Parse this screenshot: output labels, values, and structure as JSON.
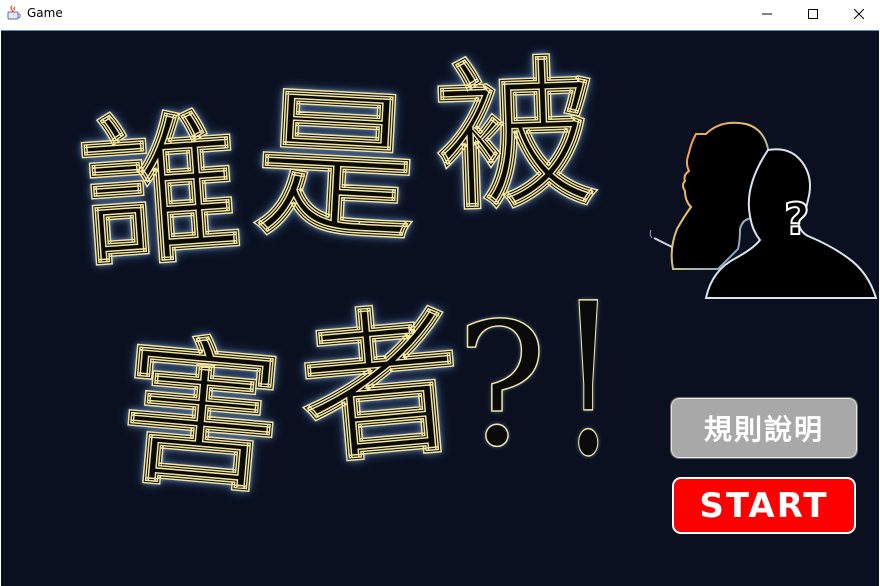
{
  "window": {
    "title": "Game"
  },
  "game_title": {
    "characters": [
      "誰",
      "是",
      "被",
      "害",
      "者"
    ],
    "question_mark": "?",
    "exclamation": "!"
  },
  "buttons": {
    "rules_label": "規則說明",
    "start_label": "START"
  },
  "colors": {
    "background": "#0a1020",
    "glyph_outline": "#f3e6a0",
    "glow": "#a0c8ff",
    "rules_button": "#a8a8a8",
    "start_button": "#ff0000"
  },
  "icons": {
    "app": "java-cup-icon",
    "silhouette": "detective-silhouettes-icon"
  }
}
